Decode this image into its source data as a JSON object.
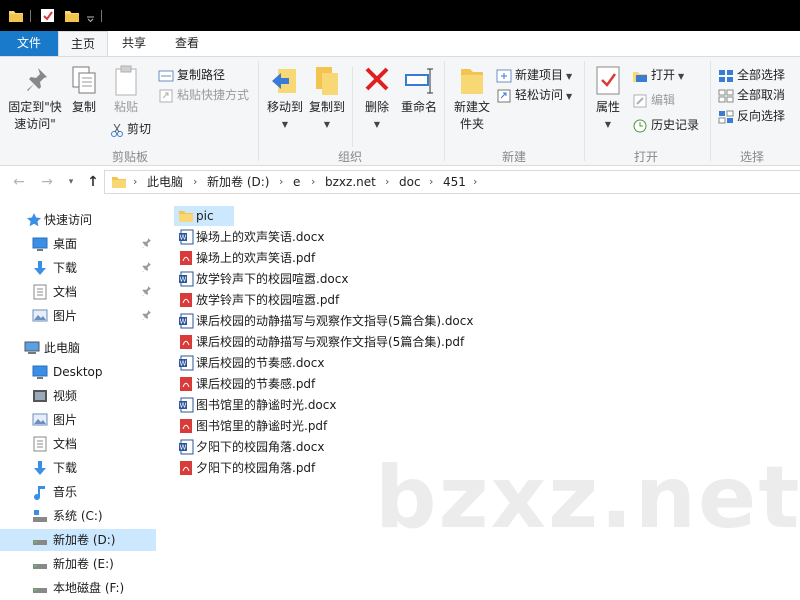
{
  "ribbon_tabs": [
    "文件",
    "主页",
    "共享",
    "查看"
  ],
  "ribbon": {
    "clipboard": {
      "group_label": "剪贴板",
      "pin_quick_access": "固定到\"快速访问\"",
      "copy": "复制",
      "paste": "粘贴",
      "copy_path": "复制路径",
      "paste_shortcut": "粘贴快捷方式",
      "cut": "剪切"
    },
    "organize": {
      "group_label": "组织",
      "move_to": "移动到",
      "copy_to": "复制到",
      "delete": "删除",
      "rename": "重命名"
    },
    "new": {
      "group_label": "新建",
      "new_folder": "新建文件夹",
      "new_item": "新建项目",
      "easy_access": "轻松访问"
    },
    "open": {
      "group_label": "打开",
      "properties": "属性",
      "open": "打开",
      "edit": "编辑",
      "history": "历史记录"
    },
    "select": {
      "group_label": "选择",
      "select_all": "全部选择",
      "select_none": "全部取消",
      "invert": "反向选择"
    }
  },
  "address": {
    "breadcrumbs": [
      "此电脑",
      "新加卷 (D:)",
      "e",
      "bzxz.net",
      "doc",
      "451"
    ]
  },
  "nav_pane": {
    "quick_access": "快速访问",
    "quick_items": [
      "桌面",
      "下载",
      "文档",
      "图片"
    ],
    "this_pc": "此电脑",
    "pc_items": [
      "Desktop",
      "视频",
      "图片",
      "文档",
      "下载",
      "音乐",
      "系统 (C:)",
      "新加卷 (D:)",
      "新加卷 (E:)",
      "本地磁盘 (F:)"
    ]
  },
  "files": [
    {
      "name": "pic",
      "type": "folder"
    },
    {
      "name": "操场上的欢声笑语.docx",
      "type": "docx"
    },
    {
      "name": "操场上的欢声笑语.pdf",
      "type": "pdf"
    },
    {
      "name": "放学铃声下的校园喧嚣.docx",
      "type": "docx"
    },
    {
      "name": "放学铃声下的校园喧嚣.pdf",
      "type": "pdf"
    },
    {
      "name": "课后校园的动静描写与观察作文指导(5篇合集).docx",
      "type": "docx"
    },
    {
      "name": "课后校园的动静描写与观察作文指导(5篇合集).pdf",
      "type": "pdf"
    },
    {
      "name": "课后校园的节奏感.docx",
      "type": "docx"
    },
    {
      "name": "课后校园的节奏感.pdf",
      "type": "pdf"
    },
    {
      "name": "图书馆里的静谧时光.docx",
      "type": "docx"
    },
    {
      "name": "图书馆里的静谧时光.pdf",
      "type": "pdf"
    },
    {
      "name": "夕阳下的校园角落.docx",
      "type": "docx"
    },
    {
      "name": "夕阳下的校园角落.pdf",
      "type": "pdf"
    }
  ],
  "watermark": "bzxz.net",
  "colors": {
    "accent": "#1979ca",
    "selection": "#cce8ff",
    "folder": "#f8d775",
    "word": "#2b579a",
    "pdf": "#d93b3b"
  }
}
